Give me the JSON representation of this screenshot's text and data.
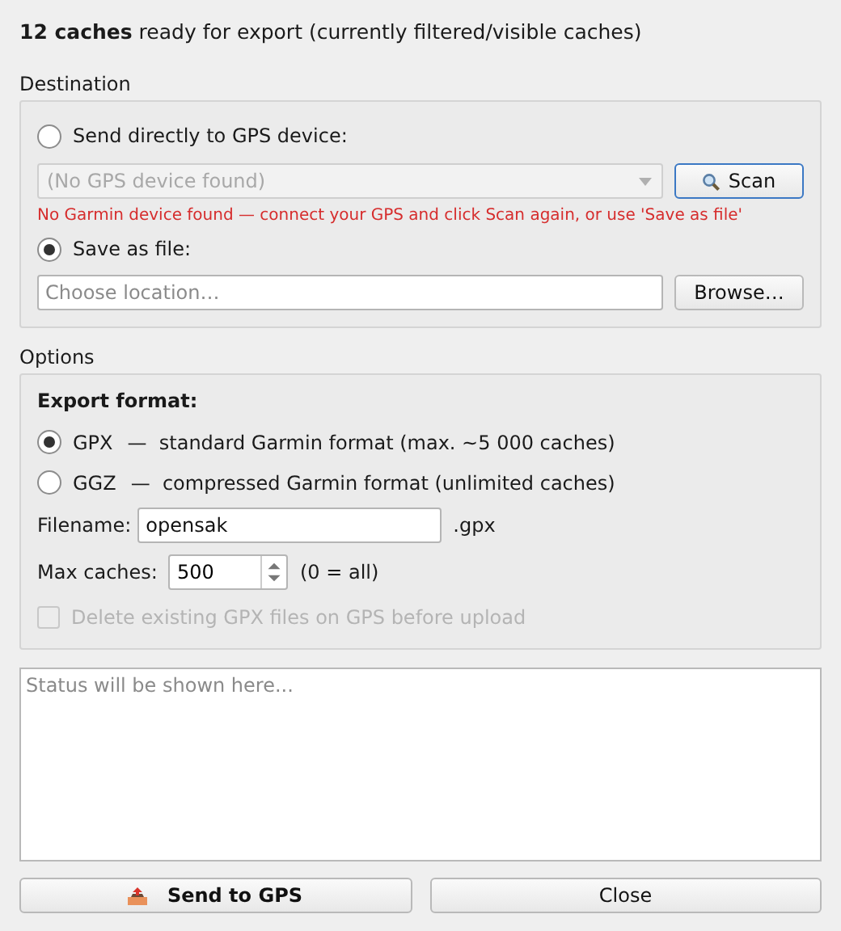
{
  "summary": "**12 caches** ready for export (currently filtered/visible caches)",
  "destination": {
    "title": "Destination",
    "options": [
      {
        "label": "Send directly to GPS device:",
        "selected": false
      },
      {
        "label": "Save as file:",
        "selected": true
      }
    ],
    "device_select": {
      "value": "(No GPS device found)",
      "disabled": true
    },
    "scan_button": "Scan",
    "error": "No Garmin device found — connect your GPS and click Scan again, or use 'Save as file'",
    "location": {
      "placeholder": "Choose location…"
    },
    "browse_button": "Browse…"
  },
  "options": {
    "title": "Options",
    "format_label": "Export format:",
    "formats": [
      {
        "code": "GPX",
        "description": "—  standard Garmin format (max. ~5 000 caches)",
        "selected": true
      },
      {
        "code": "GGZ",
        "description": "—  compressed Garmin format (unlimited caches)",
        "selected": false
      }
    ],
    "filename_label": "Filename:",
    "filename": "opensak",
    "extension": ".gpx",
    "max_label": "Max caches:",
    "max_value": "500",
    "max_hint": "(0 = all)",
    "delete_option": {
      "label": "Delete existing GPX files on GPS before upload",
      "checked": false,
      "disabled": true
    }
  },
  "status": {
    "placeholder": "Status will be shown here..."
  },
  "buttons": [
    {
      "kind": "primary",
      "label": "Send to GPS"
    },
    {
      "kind": "plain",
      "label": "Close"
    }
  ]
}
